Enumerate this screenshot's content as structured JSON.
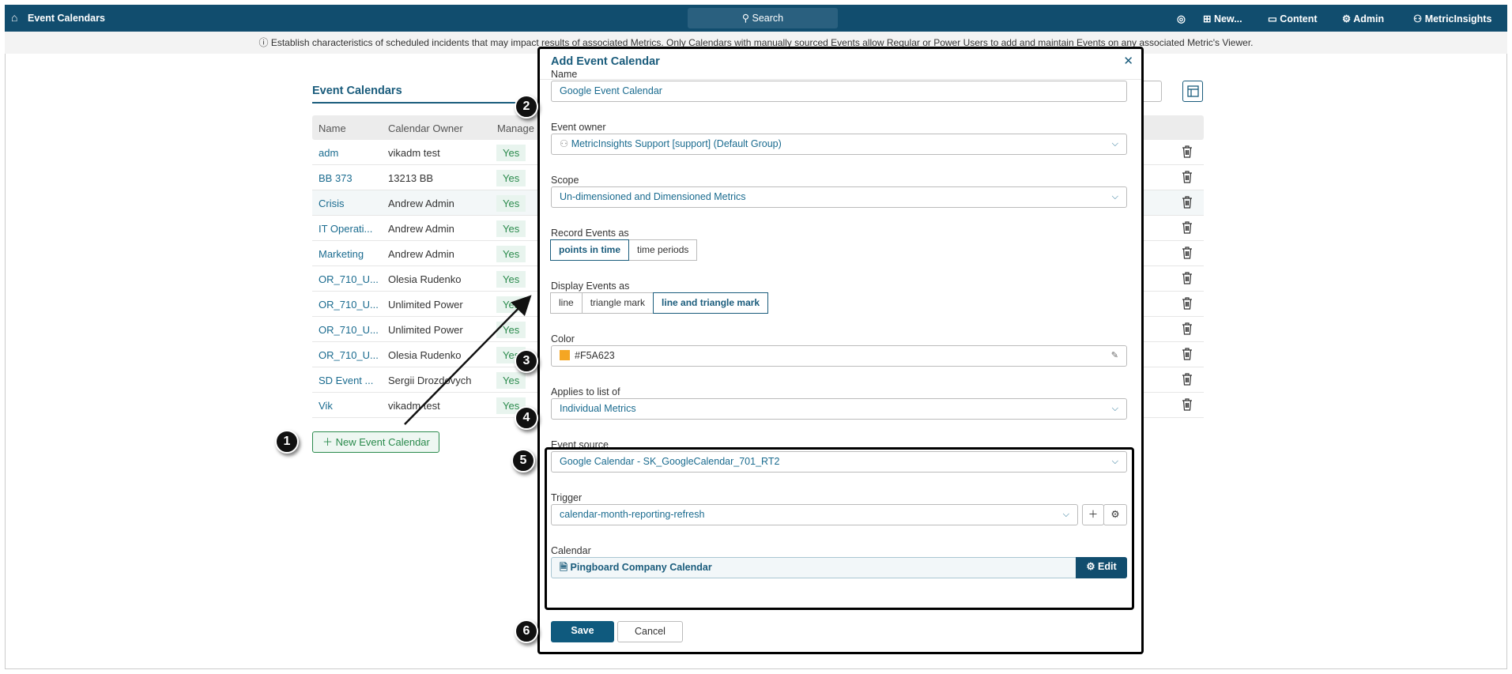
{
  "topbar": {
    "title": "Event Calendars",
    "search": "Search",
    "new": "New...",
    "content": "Content",
    "admin": "Admin",
    "user": "MetricInsights"
  },
  "info": "Establish characteristics of scheduled incidents that may impact results of associated Metrics. Only Calendars with manually sourced Events allow Regular or Power Users to add and maintain Events on any associated Metric's Viewer.",
  "list": {
    "title": "Event Calendars",
    "columns": [
      "Name",
      "Calendar Owner",
      "Manage"
    ],
    "rows": [
      {
        "name": "adm",
        "owner": "vikadm test",
        "manage": "Yes"
      },
      {
        "name": "BB 373",
        "owner": "13213 BB",
        "manage": "Yes"
      },
      {
        "name": "Crisis",
        "owner": "Andrew Admin",
        "manage": "Yes"
      },
      {
        "name": "IT Operati...",
        "owner": "Andrew Admin",
        "manage": "Yes"
      },
      {
        "name": "Marketing",
        "owner": "Andrew Admin",
        "manage": "Yes"
      },
      {
        "name": "OR_710_U...",
        "owner": "Olesia Rudenko",
        "manage": "Yes"
      },
      {
        "name": "OR_710_U...",
        "owner": "Unlimited Power",
        "manage": "Yes"
      },
      {
        "name": "OR_710_U...",
        "owner": "Unlimited Power",
        "manage": "Yes"
      },
      {
        "name": "OR_710_U...",
        "owner": "Olesia Rudenko",
        "manage": "Yes"
      },
      {
        "name": "SD Event ...",
        "owner": "Sergii Drozdovych",
        "manage": "Yes"
      },
      {
        "name": "Vik",
        "owner": "vikadm test",
        "manage": "Yes"
      }
    ],
    "new_button": "New Event Calendar"
  },
  "modal": {
    "title": "Add Event Calendar",
    "name_label": "Name",
    "name_value": "Google Event Calendar",
    "owner_label": "Event owner",
    "owner_value": "MetricInsights Support [support] (Default Group)",
    "scope_label": "Scope",
    "scope_value": "Un-dimensioned and Dimensioned Metrics",
    "record_label": "Record Events as",
    "record_options": [
      "points in time",
      "time periods"
    ],
    "record_selected": "points in time",
    "display_label": "Display Events as",
    "display_options": [
      "line",
      "triangle mark",
      "line and triangle mark"
    ],
    "display_selected": "line and triangle mark",
    "color_label": "Color",
    "color_value": "#F5A623",
    "applies_label": "Applies to list of",
    "applies_value": "Individual Metrics",
    "source_label": "Event source",
    "source_value": "Google Calendar - SK_GoogleCalendar_701_RT2",
    "trigger_label": "Trigger",
    "trigger_value": "calendar-month-reporting-refresh",
    "calendar_label": "Calendar",
    "calendar_value": "Pingboard Company Calendar",
    "edit": "Edit",
    "save": "Save",
    "cancel": "Cancel"
  },
  "callouts": [
    "1",
    "2",
    "3",
    "4",
    "5",
    "6"
  ],
  "colors": {
    "brand": "#114d6e",
    "accent": "#1a5c7c",
    "swatch": "#F5A623"
  }
}
